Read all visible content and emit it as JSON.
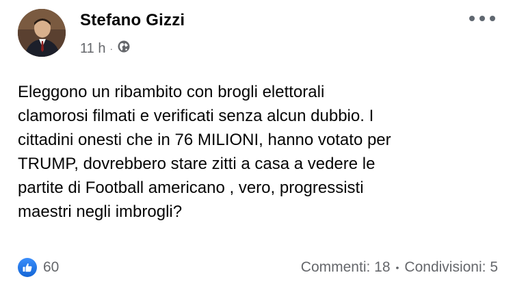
{
  "post": {
    "author": "Stefano Gizzi",
    "time": "11 h",
    "separator": "·",
    "privacy_icon": "globe-icon",
    "more_icon": "more-options-icon",
    "text": "Eleggono un ribambito con brogli elettorali\nclamorosi filmati e verificati senza alcun dubbio. I\ncittadini onesti che in 76 MILIONI, hanno votato per\nTRUMP, dovrebbero stare zitti a casa a vedere le\npartite di Football americano , vero, progressisti\nmaestri negli imbrogli?",
    "reactions": {
      "icon": "like-icon",
      "count": "60"
    },
    "comments": "Commenti: 18",
    "stats_separator": "•",
    "shares": "Condivisioni: 5"
  },
  "colors": {
    "like_blue": "#1877f2",
    "secondary_text": "#65676b",
    "primary_text": "#050505"
  }
}
